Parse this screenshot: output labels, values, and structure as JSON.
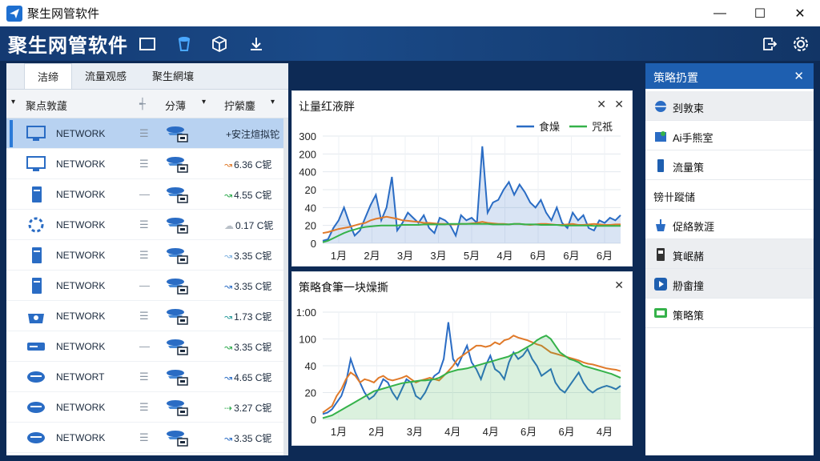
{
  "app": {
    "title": "聚生网管软件",
    "banner_title": "聚生网管软件",
    "win_min": "—",
    "win_max": "☐",
    "win_close": "✕"
  },
  "tabs": [
    {
      "label": "洁缔"
    },
    {
      "label": "流量观感"
    },
    {
      "label": "聚生網壤"
    }
  ],
  "columns": {
    "c1": "聚点敦蘐",
    "c2": "分薄",
    "c3": "拧縈鏖",
    "c1_arrow": "▾",
    "c2_arrow": "▾",
    "c3_arrow": "▾",
    "c_mid": "┽"
  },
  "rows": [
    {
      "name": "NETWORK",
      "handle": "☰",
      "traffic": "+安注煊拟铊",
      "trend": "",
      "trend_color": "#2a6cc4",
      "selected": true
    },
    {
      "name": "NETWORK",
      "handle": "☰",
      "traffic": "6.36 C铌",
      "trend": "↝",
      "trend_color": "#e07a2a",
      "selected": false
    },
    {
      "name": "NETWORK",
      "handle": "—",
      "traffic": "4.55 C铌",
      "trend": "↝",
      "trend_color": "#2aa84a",
      "selected": false
    },
    {
      "name": "NETWORK",
      "handle": "☰",
      "traffic": "0.17 C铌",
      "trend": "☁",
      "trend_color": "#b9c0c8",
      "selected": false
    },
    {
      "name": "NETWORK",
      "handle": "☰",
      "traffic": "3.35 C铌",
      "trend": "↝",
      "trend_color": "#7fb2e0",
      "selected": false
    },
    {
      "name": "NETWORK",
      "handle": "—",
      "traffic": "3.35 C铌",
      "trend": "↝",
      "trend_color": "#2a6cc4",
      "selected": false
    },
    {
      "name": "NETWORK",
      "handle": "☰",
      "traffic": "1.73 C铌",
      "trend": "↝",
      "trend_color": "#2a9c9c",
      "selected": false
    },
    {
      "name": "NETWORK",
      "handle": "—",
      "traffic": "3.35 C铌",
      "trend": "↝",
      "trend_color": "#2aa84a",
      "selected": false
    },
    {
      "name": "NETWORT",
      "handle": "☰",
      "traffic": "4.65 C铌",
      "trend": "↝",
      "trend_color": "#2a6cc4",
      "selected": false
    },
    {
      "name": "NETWORK",
      "handle": "☰",
      "traffic": "3.27 C铌",
      "trend": "⇢",
      "trend_color": "#2aa84a",
      "selected": false
    },
    {
      "name": "NETWORK",
      "handle": "☰",
      "traffic": "3.35 C铌",
      "trend": "↝",
      "trend_color": "#2a6cc4",
      "selected": false
    }
  ],
  "colors": {
    "accent": "#1e5fb0",
    "blue": "#2a6cc4",
    "orange": "#e07a2a",
    "green": "#35b24a"
  },
  "chart_data": [
    {
      "type": "line",
      "title": "让量红液胖",
      "ytick_labels": [
        "300",
        "200",
        "400",
        "20",
        "40",
        "20",
        "0"
      ],
      "xtick_labels": [
        "1月",
        "2月",
        "3月",
        "3月",
        "5月",
        "4月",
        "6月",
        "6月",
        "6月"
      ],
      "legend": [
        {
          "name": "食燥",
          "color": "#2a6cc4"
        },
        {
          "name": "咒祇",
          "color": "#35b24a"
        }
      ],
      "legend_position": "top-right",
      "grid": true,
      "series": [
        {
          "color": "#2a6cc4",
          "area": true,
          "values": [
            5,
            8,
            30,
            45,
            70,
            40,
            15,
            25,
            50,
            75,
            95,
            45,
            70,
            130,
            25,
            40,
            60,
            50,
            40,
            55,
            30,
            20,
            50,
            45,
            35,
            15,
            55,
            45,
            50,
            40,
            190,
            60,
            80,
            85,
            105,
            120,
            95,
            115,
            100,
            80,
            70,
            85,
            60,
            45,
            70,
            40,
            30,
            60,
            45,
            55,
            30,
            25,
            45,
            40,
            50,
            45,
            55
          ]
        },
        {
          "color": "#e07a2a",
          "area": false,
          "values": [
            20,
            22,
            25,
            28,
            30,
            32,
            35,
            38,
            40,
            45,
            48,
            50,
            52,
            50,
            48,
            45,
            44,
            43,
            42,
            40,
            40,
            39,
            38,
            38,
            37,
            37,
            38,
            38,
            39,
            40,
            42,
            40,
            39,
            38,
            38,
            37,
            38,
            38,
            37,
            36,
            37,
            38,
            38,
            37,
            36,
            36,
            37,
            38,
            36,
            36,
            37,
            38,
            37,
            36,
            36,
            37,
            37
          ]
        },
        {
          "color": "#35b24a",
          "area": false,
          "values": [
            2,
            5,
            10,
            15,
            20,
            24,
            27,
            30,
            32,
            33,
            34,
            35,
            35,
            35,
            35,
            36,
            36,
            36,
            36,
            37,
            37,
            37,
            37,
            37,
            38,
            38,
            38,
            38,
            38,
            38,
            38,
            38,
            37,
            37,
            37,
            37,
            38,
            38,
            37,
            37,
            37,
            36,
            36,
            36,
            36,
            35,
            35,
            35,
            35,
            35,
            35,
            34,
            34,
            34,
            34,
            34,
            34
          ]
        }
      ]
    },
    {
      "type": "line",
      "title": "策略食筆一块燥撕",
      "ytick_labels": [
        "1:00",
        "100",
        "40",
        "20",
        "0"
      ],
      "xtick_labels": [
        "1月",
        "2月",
        "3月",
        "4月",
        "4月",
        "6月",
        "6月",
        "4月"
      ],
      "grid": true,
      "series": [
        {
          "color": "#2a6cc4",
          "area": false,
          "values": [
            8,
            10,
            15,
            25,
            35,
            55,
            90,
            70,
            55,
            40,
            30,
            35,
            45,
            60,
            55,
            40,
            30,
            45,
            60,
            55,
            35,
            30,
            40,
            55,
            65,
            70,
            90,
            145,
            90,
            80,
            95,
            110,
            85,
            75,
            60,
            80,
            95,
            75,
            70,
            60,
            85,
            100,
            90,
            95,
            105,
            90,
            80,
            65,
            70,
            75,
            55,
            45,
            40,
            50,
            60,
            70,
            55,
            45,
            40,
            45,
            48,
            50,
            48,
            45,
            50
          ]
        },
        {
          "color": "#e07a2a",
          "area": false,
          "values": [
            10,
            15,
            20,
            35,
            45,
            60,
            70,
            65,
            55,
            60,
            58,
            55,
            62,
            65,
            60,
            58,
            60,
            62,
            65,
            60,
            55,
            58,
            60,
            62,
            60,
            58,
            65,
            72,
            80,
            90,
            95,
            100,
            105,
            110,
            110,
            108,
            110,
            115,
            112,
            118,
            120,
            125,
            122,
            120,
            118,
            115,
            112,
            110,
            105,
            100,
            98,
            96,
            94,
            92,
            90,
            88,
            85,
            83,
            82,
            80,
            78,
            76,
            75,
            74,
            72
          ]
        },
        {
          "color": "#35b24a",
          "area": true,
          "values": [
            2,
            4,
            6,
            10,
            14,
            18,
            22,
            26,
            30,
            34,
            38,
            42,
            44,
            46,
            48,
            50,
            52,
            54,
            55,
            56,
            57,
            58,
            58,
            59,
            60,
            62,
            66,
            70,
            72,
            74,
            75,
            76,
            78,
            80,
            82,
            84,
            86,
            88,
            90,
            92,
            94,
            98,
            100,
            104,
            108,
            112,
            118,
            122,
            125,
            120,
            110,
            100,
            95,
            90,
            88,
            85,
            80,
            78,
            76,
            74,
            72,
            70,
            68,
            65,
            62
          ]
        }
      ]
    }
  ],
  "right_panel": {
    "title": "策略扔置",
    "close": "✕",
    "items": [
      {
        "label": "刭敦柬",
        "alt": true,
        "section": false
      },
      {
        "label": "Ai手熊室",
        "alt": false,
        "section": false
      },
      {
        "label": "流量策",
        "alt": false,
        "section": false
      },
      {
        "label": "镑卄蹤储",
        "alt": false,
        "section": true
      },
      {
        "label": "促絡敦涯",
        "alt": false,
        "section": false
      },
      {
        "label": "箕岷赭",
        "alt": true,
        "section": false
      },
      {
        "label": "刱畬撞",
        "alt": true,
        "section": false
      },
      {
        "label": "策略策",
        "alt": false,
        "section": false
      }
    ]
  }
}
